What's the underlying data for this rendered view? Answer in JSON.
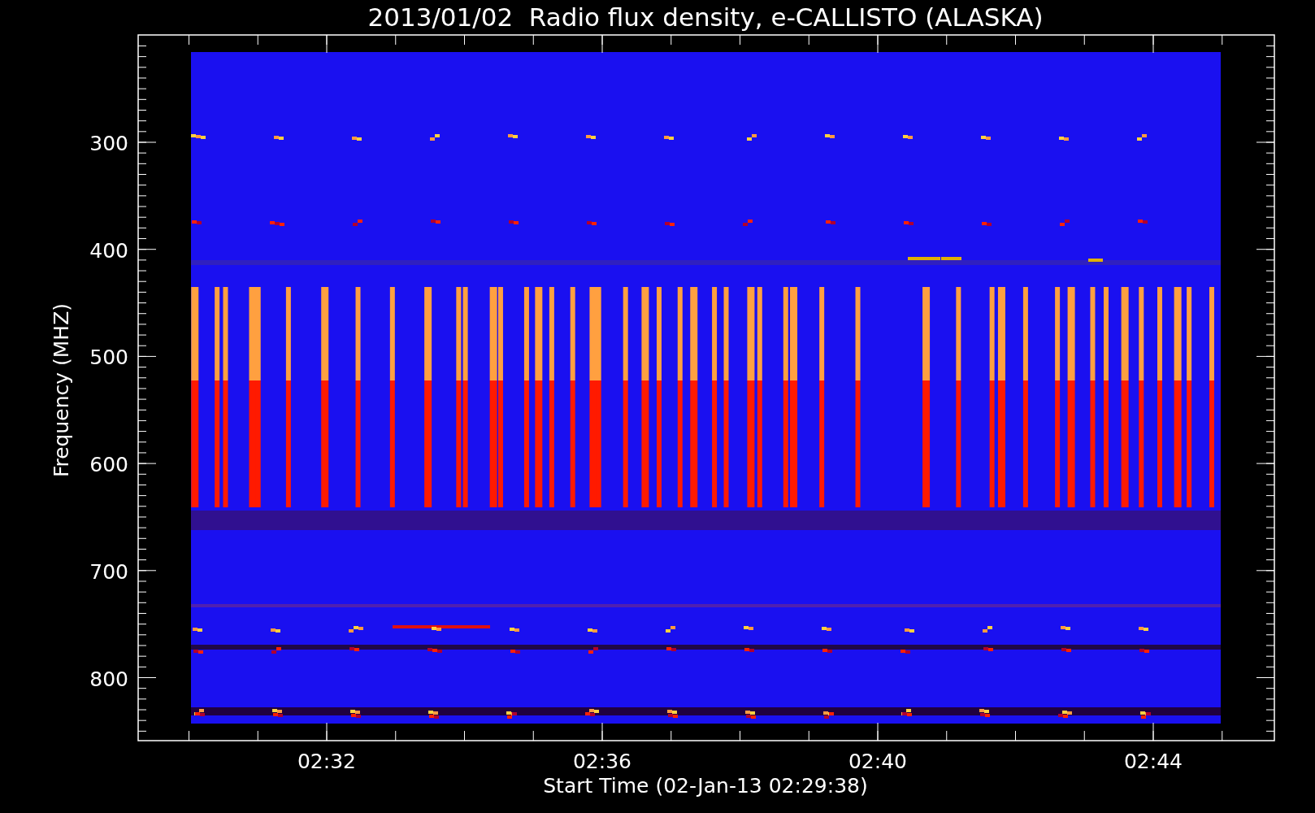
{
  "title": "2013/01/02  Radio flux density, e-CALLISTO (ALASKA)",
  "y_axis": {
    "title": "Frequency (MHZ)",
    "ticks": [
      "300",
      "400",
      "500",
      "600",
      "700",
      "800"
    ]
  },
  "x_axis": {
    "title": "Start Time (02-Jan-13 02:29:38)",
    "ticks": [
      "02:32",
      "02:36",
      "02:40",
      "02:44"
    ]
  }
}
